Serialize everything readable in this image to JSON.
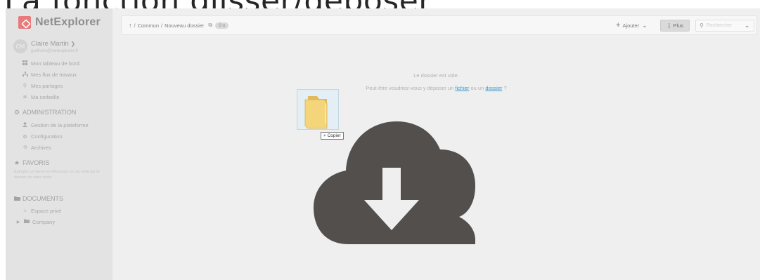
{
  "slide": {
    "title": "La fonction glisser/déposer"
  },
  "app": {
    "name": "NetExplorer"
  },
  "user": {
    "initials": "CM",
    "name": "Claire Martin",
    "email": "guilhem@netexplorer.fr"
  },
  "nav": [
    {
      "icon": "dashboard-icon",
      "label": "Mon tableau de bord"
    },
    {
      "icon": "workflow-icon",
      "label": "Mes flux de travaux"
    },
    {
      "icon": "share-icon",
      "label": "Mes partages"
    },
    {
      "icon": "trash-icon",
      "label": "Ma corbeille"
    }
  ],
  "admin": {
    "title": "ADMINISTRATION",
    "items": [
      {
        "icon": "user-icon",
        "label": "Gestion de la plateforme"
      },
      {
        "icon": "gear-icon",
        "label": "Configuration"
      },
      {
        "icon": "archive-icon",
        "label": "Archives"
      }
    ]
  },
  "favorites": {
    "title": "FAVORIS",
    "hint": "Épinglez un favori en effectuant un clic-droit sur le dossier de votre choix"
  },
  "documents": {
    "title": "DOCUMENTS",
    "items": [
      {
        "icon": "home-icon",
        "label": "Espace privé"
      },
      {
        "icon": "folder-icon",
        "label": "Company"
      }
    ]
  },
  "breadcrumb": {
    "root": "Commun",
    "current": "Nouveau dossier",
    "size": "0 o"
  },
  "toolbar": {
    "add_label": "Ajouter",
    "more_label": "Plus",
    "search_placeholder": "Rechercher"
  },
  "empty": {
    "line1": "Le dossier est vide.",
    "line2_prefix": "Peut-être voudriez-vous y déposer un ",
    "link_file": "fichier",
    "line2_mid": " ou un ",
    "link_folder": "dossier",
    "line2_suffix": " ?"
  },
  "drag": {
    "tooltip": "+ Copier"
  },
  "colors": {
    "brand": "#e87a7a",
    "link": "#3399cc",
    "cloud": "#524f4d",
    "folder": "#f4d57a"
  }
}
